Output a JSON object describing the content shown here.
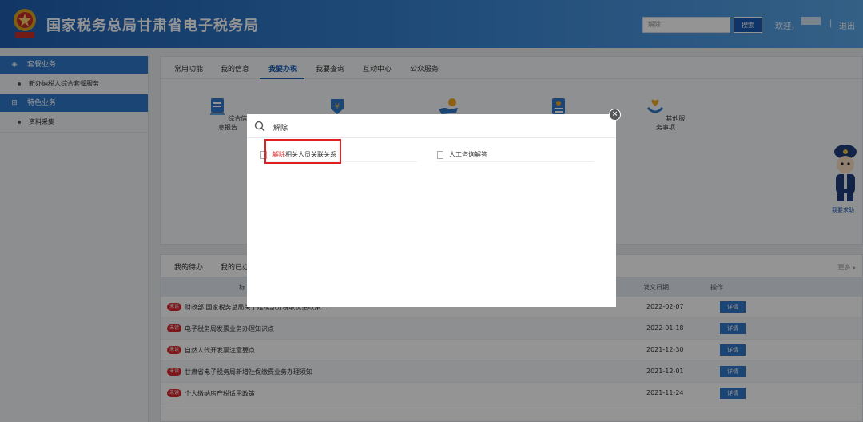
{
  "header": {
    "title": "国家税务总局甘肃省电子税务局",
    "search_value": "解除",
    "search_button": "搜索",
    "welcome": "欢迎，",
    "separator": "|",
    "logout": "退出"
  },
  "sidebar": {
    "groups": [
      {
        "label": "套餐业务",
        "items": [
          "新办纳税人综合套餐服务"
        ]
      },
      {
        "label": "特色业务",
        "items": [
          "资料采集"
        ]
      }
    ]
  },
  "main": {
    "tabs": [
      "常用功能",
      "我的信息",
      "我要办税",
      "我要查询",
      "互动中心",
      "公众服务"
    ],
    "active_tab": "我要办税",
    "services": [
      {
        "label": "综合信息报告",
        "icon": "report-icon"
      },
      {
        "label": "",
        "icon": "tax-shield-icon"
      },
      {
        "label": "",
        "icon": "hand-coin-icon"
      },
      {
        "label": "",
        "icon": "doc-list-icon"
      },
      {
        "label": "其他服务事项",
        "icon": "heart-hand-icon"
      }
    ]
  },
  "news": {
    "tabs": [
      "我的待办",
      "我的已办"
    ],
    "more": "更多",
    "columns": {
      "title": "标",
      "date": "发文日期",
      "action": "操作"
    },
    "badge": "未读",
    "detail_label": "详情",
    "rows": [
      {
        "title": "财政部 国家税务总局关于延续部分税收优惠政策...",
        "date": "2022-02-07"
      },
      {
        "title": "电子税务局发票业务办理知识点",
        "date": "2022-01-18"
      },
      {
        "title": "自然人代开发票注意要点",
        "date": "2021-12-30"
      },
      {
        "title": "甘肃省电子税务局新增社保缴费业务办理须知",
        "date": "2021-12-01"
      },
      {
        "title": "个人缴纳房产税适用政策",
        "date": "2021-11-24"
      }
    ]
  },
  "helper": {
    "label": "我要求助"
  },
  "modal": {
    "query": "解除",
    "results": [
      {
        "highlight": "解除",
        "rest": "相关人员关联关系"
      },
      {
        "highlight": "",
        "rest": "人工咨询解答"
      }
    ],
    "close": "×"
  },
  "colors": {
    "header_blue": "#2d78c8",
    "accent": "#1a5bb5",
    "unread_red": "#d7262b",
    "annotation_red": "#e02020"
  }
}
